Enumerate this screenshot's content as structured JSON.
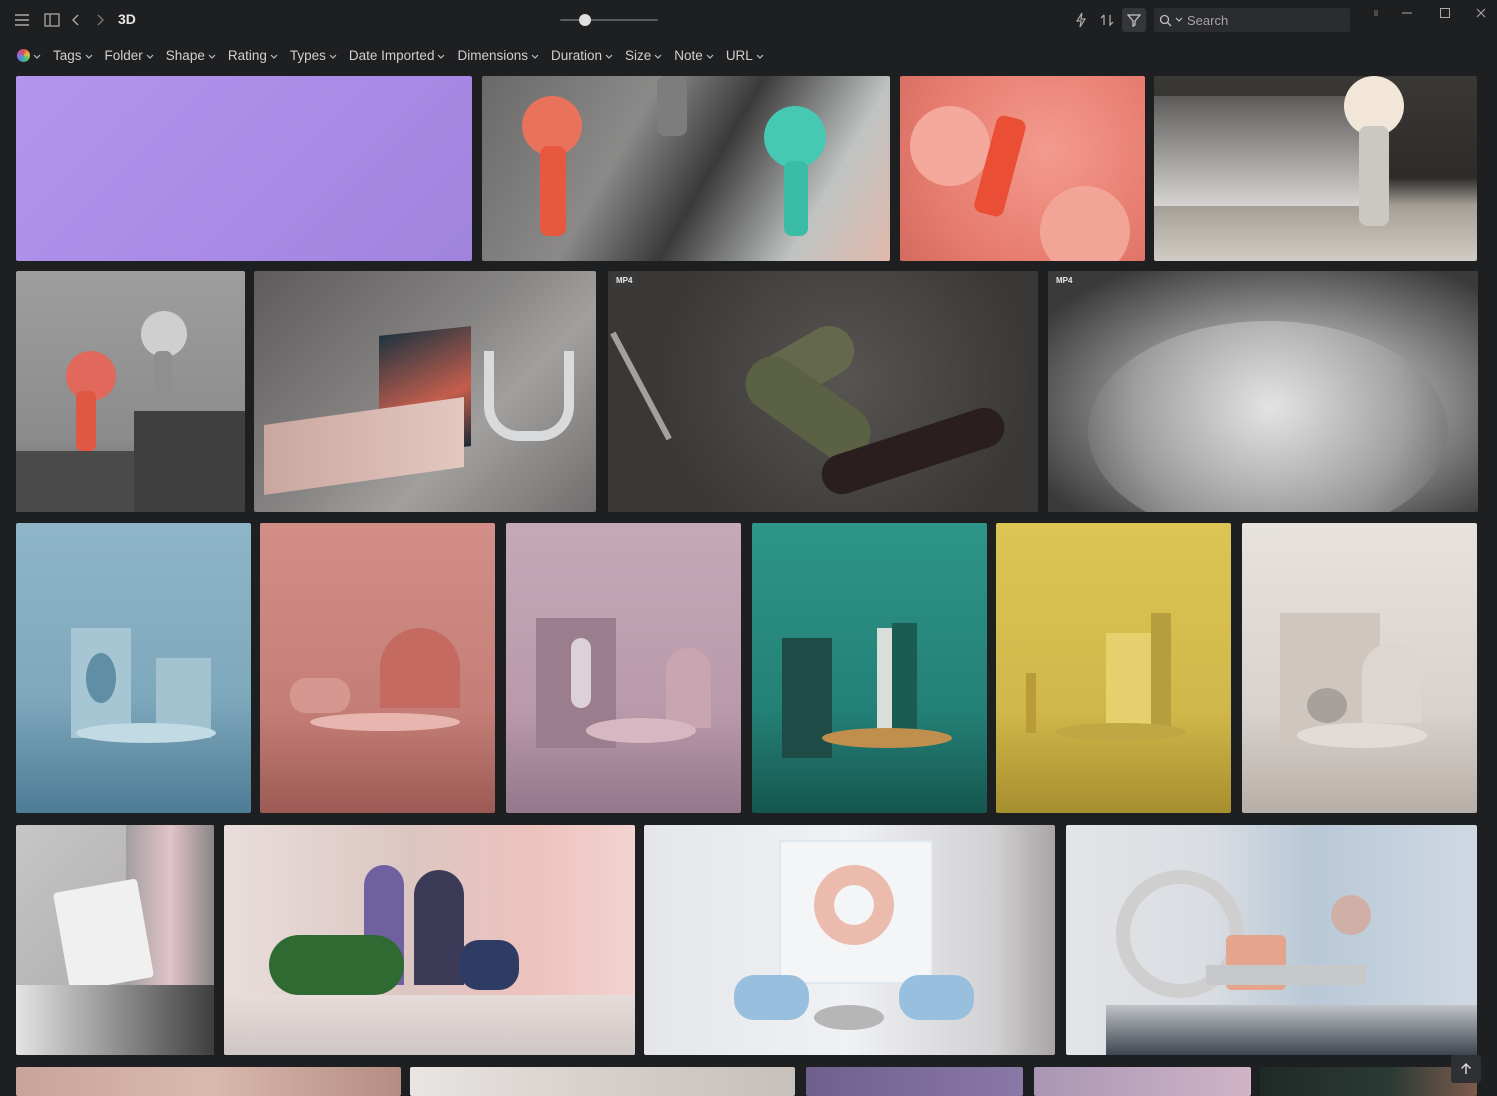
{
  "window": {
    "title": "3D"
  },
  "search": {
    "placeholder": "Search"
  },
  "filters": [
    "Tags",
    "Folder",
    "Shape",
    "Rating",
    "Types",
    "Date Imported",
    "Dimensions",
    "Duration",
    "Size",
    "Note",
    "URL"
  ],
  "thumbnail_size": 0.25,
  "badges": {
    "mp4": "MP4"
  },
  "colors": {
    "background": "#1e1f21",
    "toolbar_icon": "#a9a9a9",
    "active_filter_bg": "#34363a"
  }
}
